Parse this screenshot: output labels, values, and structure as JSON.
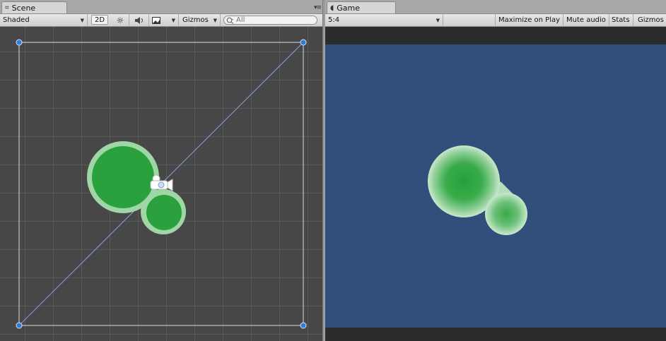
{
  "scene": {
    "tab_label": "Scene",
    "toolbar": {
      "shading_mode": "Shaded",
      "mode_2d": "2D",
      "gizmos_label": "Gizmos",
      "search_placeholder": "All"
    }
  },
  "game": {
    "tab_label": "Game",
    "toolbar": {
      "aspect": "5:4",
      "maximize_label": "Maximize on Play",
      "mute_label": "Mute audio",
      "stats_label": "Stats",
      "gizmos_label": "Gizmos"
    },
    "background_color": "#30507b"
  },
  "colors": {
    "blob_green": "#2aa13c",
    "blob_glow": "#9fd6a6",
    "handle_blue": "#2f7bd6",
    "scene_bg": "#474747"
  },
  "icons": [
    "scene-grid-icon",
    "sun-icon",
    "speaker-icon",
    "image-icon",
    "search-icon",
    "game-pacman-icon",
    "camera-gizmo-icon",
    "dropdown-arrow-icon"
  ]
}
